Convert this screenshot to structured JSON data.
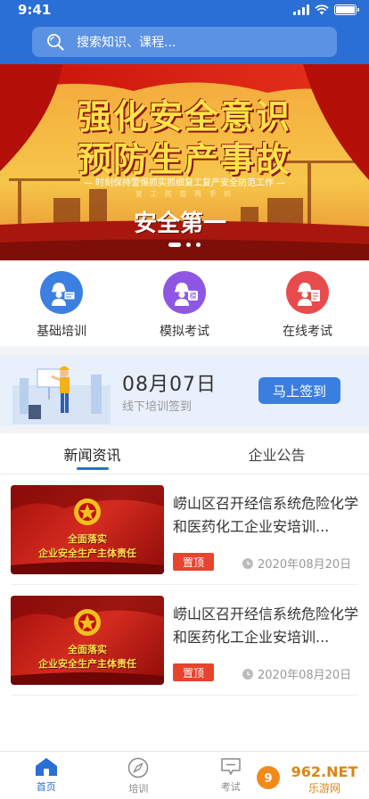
{
  "status": {
    "time": "9:41"
  },
  "search": {
    "placeholder": "搜索知识、课程..."
  },
  "banner": {
    "title_line1": "强化安全意识",
    "title_line2": "预防生产事故",
    "subtitle": "— 时刻保持警惕抓实抓细复工复产安全防范工作 —",
    "subtitle2": "复 工 防 疫 两 手 抓",
    "slogan": "安全第一",
    "slide_count": 3,
    "active_slide": 0
  },
  "quick_nav": [
    {
      "label": "基础培训",
      "color": "#3b7fe0",
      "icon": "worker-presentation-icon"
    },
    {
      "label": "模拟考试",
      "color": "#8e57e3",
      "icon": "worker-simulation-icon"
    },
    {
      "label": "在线考试",
      "color": "#e84b4b",
      "icon": "worker-exam-icon"
    }
  ],
  "signin": {
    "date": "08月07日",
    "subtitle": "线下培训签到",
    "button_label": "马上签到"
  },
  "tabs": [
    {
      "label": "新闻资讯",
      "active": true
    },
    {
      "label": "企业公告",
      "active": false
    }
  ],
  "news": [
    {
      "title": "崂山区召开经信系统危险化学和医药化工企业安培训...",
      "tag": "置顶",
      "date": "2020年08月20日",
      "thumb_line1": "全面落实",
      "thumb_line2": "企业安全生产主体责任"
    },
    {
      "title": "崂山区召开经信系统危险化学和医药化工企业安培训...",
      "tag": "置顶",
      "date": "2020年08月20日",
      "thumb_line1": "全面落实",
      "thumb_line2": "企业安全生产主体责任"
    }
  ],
  "bottom_nav": [
    {
      "label": "首页",
      "icon": "home-icon",
      "active": true
    },
    {
      "label": "培训",
      "icon": "compass-icon",
      "active": false
    },
    {
      "label": "考试",
      "icon": "chat-icon",
      "active": false
    }
  ],
  "watermark": {
    "text": "962.NET",
    "sub": "乐游网"
  },
  "colors": {
    "primary": "#2a6fd6",
    "tag_red": "#e8432f"
  }
}
